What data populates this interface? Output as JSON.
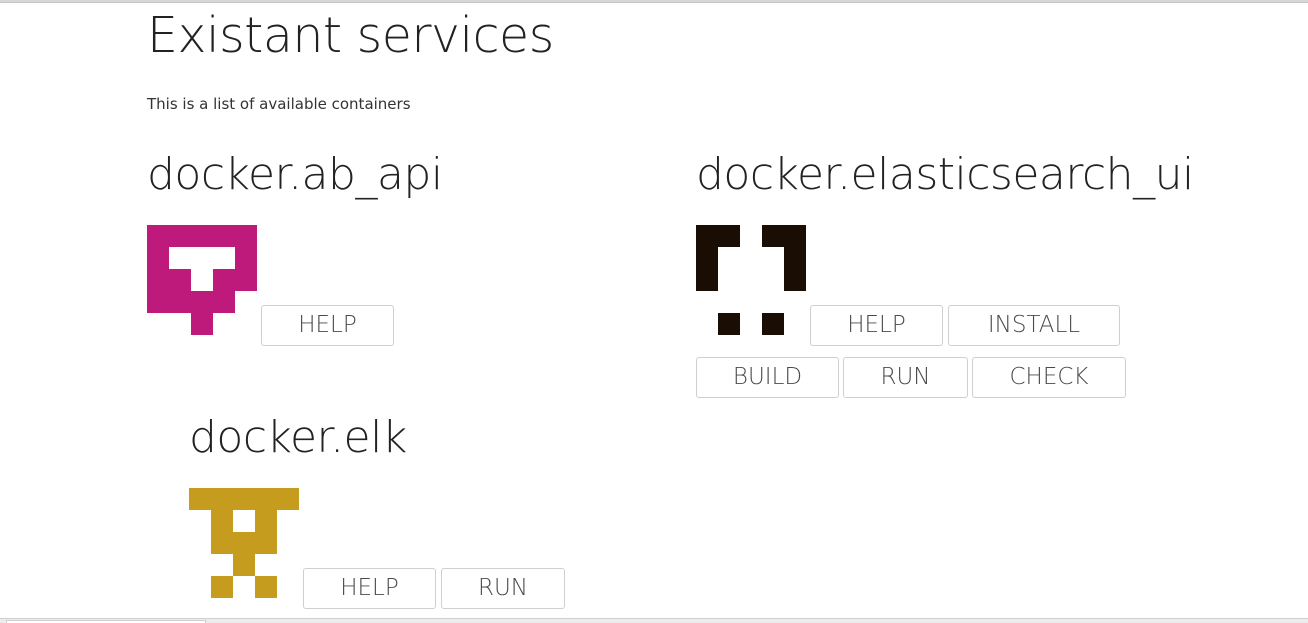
{
  "page": {
    "title": "Existant services",
    "subtitle": "This is a list of available containers"
  },
  "services": [
    {
      "name": "docker.ab_api",
      "icon": "identicon-magenta",
      "color": "#bd1a7b",
      "buttons": [
        "HELP"
      ]
    },
    {
      "name": "docker.elasticsearch_ui",
      "icon": "identicon-black",
      "color": "#1a0e04",
      "buttons": [
        "HELP",
        "INSTALL",
        "BUILD",
        "RUN",
        "CHECK"
      ]
    },
    {
      "name": "docker.elk",
      "icon": "identicon-gold",
      "color": "#c59c1d",
      "buttons": [
        "HELP",
        "RUN"
      ]
    }
  ]
}
